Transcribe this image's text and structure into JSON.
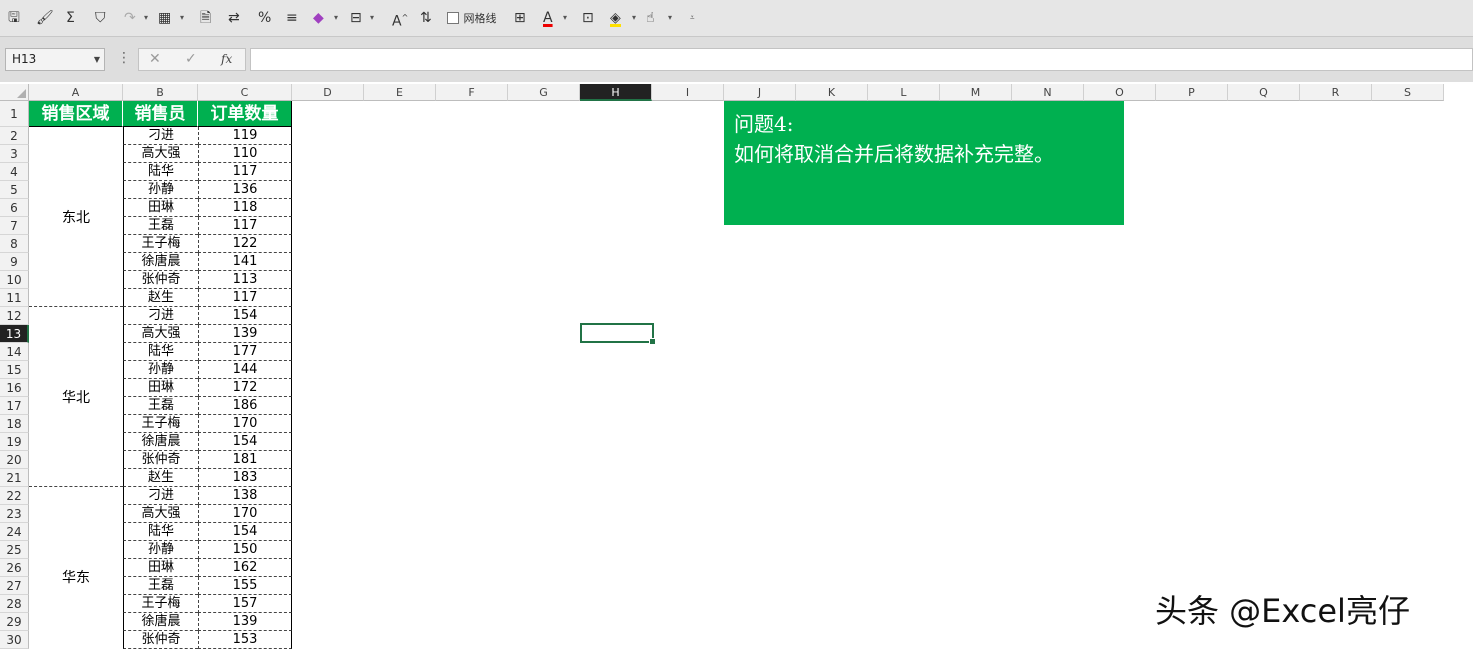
{
  "toolbar": {
    "gridlines_label": "网格线",
    "font_color": "A"
  },
  "formula_bar": {
    "name_box": "H13",
    "cancel": "✕",
    "enter": "✓",
    "fx": "fx",
    "formula": ""
  },
  "columns": [
    "A",
    "B",
    "C",
    "D",
    "E",
    "F",
    "G",
    "H",
    "I",
    "J",
    "K",
    "L",
    "M",
    "N",
    "O",
    "P",
    "Q",
    "R",
    "S"
  ],
  "selected_column": "H",
  "rows": [
    "1",
    "2",
    "3",
    "4",
    "5",
    "6",
    "7",
    "8",
    "9",
    "10",
    "11",
    "12",
    "13",
    "14",
    "15",
    "16",
    "17",
    "18",
    "19",
    "20",
    "21",
    "22",
    "23",
    "24",
    "25",
    "26",
    "27",
    "28",
    "29",
    "30"
  ],
  "selected_row": "13",
  "table": {
    "headers": [
      "销售区域",
      "销售员",
      "订单数量"
    ],
    "regions": [
      "东北",
      "华北",
      "华东"
    ],
    "data": [
      [
        "刁进",
        "119"
      ],
      [
        "高大强",
        "110"
      ],
      [
        "陆华",
        "117"
      ],
      [
        "孙静",
        "136"
      ],
      [
        "田琳",
        "118"
      ],
      [
        "王磊",
        "117"
      ],
      [
        "王子梅",
        "122"
      ],
      [
        "徐唐晨",
        "141"
      ],
      [
        "张仲奇",
        "113"
      ],
      [
        "赵生",
        "117"
      ],
      [
        "刁进",
        "154"
      ],
      [
        "高大强",
        "139"
      ],
      [
        "陆华",
        "177"
      ],
      [
        "孙静",
        "144"
      ],
      [
        "田琳",
        "172"
      ],
      [
        "王磊",
        "186"
      ],
      [
        "王子梅",
        "170"
      ],
      [
        "徐唐晨",
        "154"
      ],
      [
        "张仲奇",
        "181"
      ],
      [
        "赵生",
        "183"
      ],
      [
        "刁进",
        "138"
      ],
      [
        "高大强",
        "170"
      ],
      [
        "陆华",
        "154"
      ],
      [
        "孙静",
        "150"
      ],
      [
        "田琳",
        "162"
      ],
      [
        "王磊",
        "155"
      ],
      [
        "王子梅",
        "157"
      ],
      [
        "徐唐晨",
        "139"
      ],
      [
        "张仲奇",
        "153"
      ]
    ]
  },
  "note": {
    "line1": "问题4:",
    "line2": "如何将取消合并后将数据补充完整。"
  },
  "watermark": "头条 @Excel亮仔",
  "colors": {
    "accent": "#00b050",
    "selection": "#217346"
  }
}
